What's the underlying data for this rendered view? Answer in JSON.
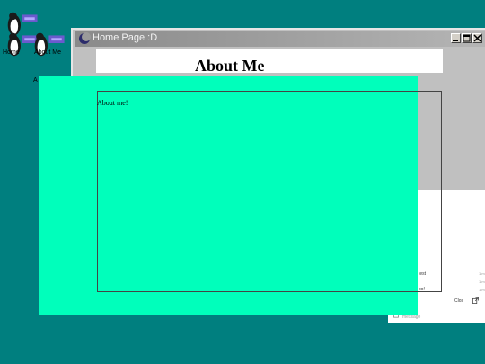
{
  "desktop": {
    "icons": [
      {
        "label": ""
      },
      {
        "label": "Home"
      },
      {
        "label": "About Me"
      }
    ]
  },
  "window": {
    "title": "Home Page :D",
    "heading": "About Me",
    "stray_text": "A"
  },
  "overlay": {
    "text": "About me!"
  },
  "chat": {
    "messages": [
      "test",
      "oo!"
    ],
    "times": [
      "1 m",
      "1 m",
      "1 m"
    ],
    "close_label": "Clos",
    "message_placeholder": "message"
  },
  "colors": {
    "desktop_bg": "#007f7f",
    "overlay_bg": "#00ffbb",
    "window_bg": "#c0c0c0"
  }
}
